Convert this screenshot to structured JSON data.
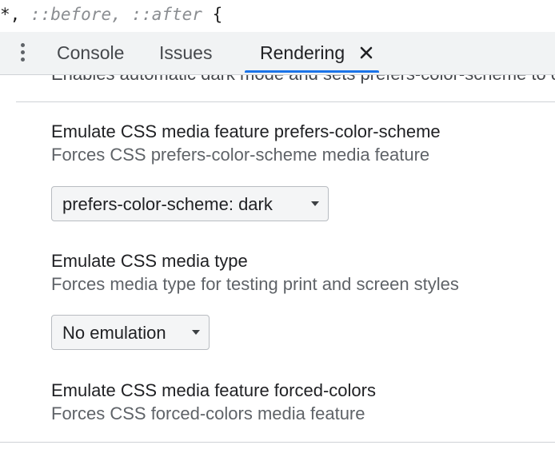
{
  "code_line": {
    "selector": "*,",
    "pseudo_before": "::before,",
    "pseudo_after": "::after",
    "brace": "{"
  },
  "tabs": [
    {
      "label": "Console"
    },
    {
      "label": "Issues"
    },
    {
      "label": "Rendering"
    }
  ],
  "active_tab": "Rendering",
  "tab_close_symbol": "×",
  "rendering": {
    "partial_text": "Enables automatic dark mode and sets prefers-color-scheme to dark.",
    "sections": [
      {
        "title": "Emulate CSS media feature prefers-color-scheme",
        "description": "Forces CSS prefers-color-scheme media feature",
        "selected": "prefers-color-scheme: dark"
      },
      {
        "title": "Emulate CSS media type",
        "description": "Forces media type for testing print and screen styles",
        "selected": "No emulation"
      },
      {
        "title": "Emulate CSS media feature forced-colors",
        "description": "Forces CSS forced-colors media feature"
      }
    ]
  },
  "colors": {
    "accent": "#1a73e8",
    "tabbar_bg": "#f1f3f4",
    "pseudo_text": "#8a8d91"
  },
  "icons": {
    "more_menu": "kebab-vertical-icon",
    "close_tab": "close-icon",
    "dropdown": "triangle-down-icon"
  }
}
